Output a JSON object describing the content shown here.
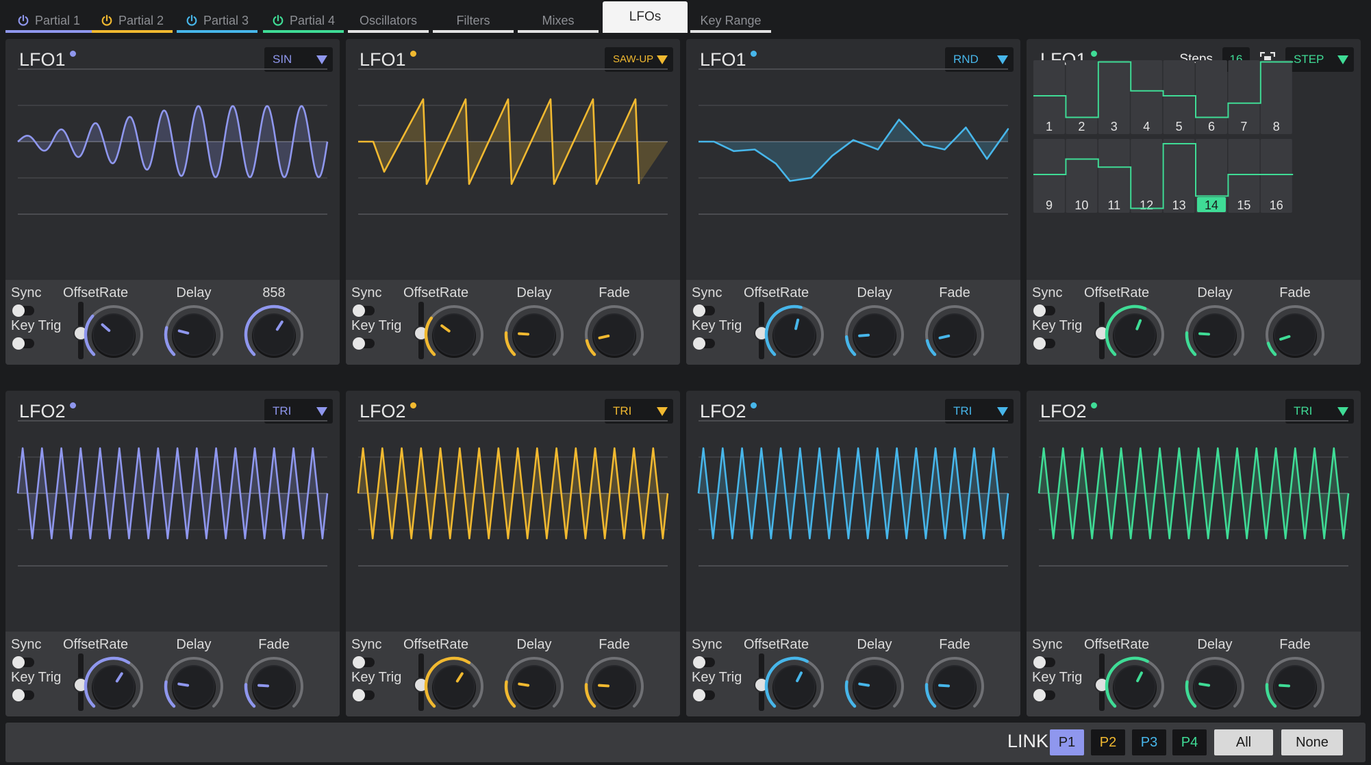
{
  "tabs": [
    {
      "label": "Partial 1",
      "power": true,
      "color": "#8f97ee"
    },
    {
      "label": "Partial 2",
      "power": true,
      "color": "#f1b930"
    },
    {
      "label": "Partial 3",
      "power": true,
      "color": "#47b6ea"
    },
    {
      "label": "Partial 4",
      "power": true,
      "color": "#3fdc96"
    },
    {
      "label": "Oscillators",
      "power": false
    },
    {
      "label": "Filters",
      "power": false
    },
    {
      "label": "Mixes",
      "power": false
    },
    {
      "label": "LFOs",
      "power": false,
      "active": true
    },
    {
      "label": "Key Range",
      "power": false
    }
  ],
  "partial_colors": [
    "#8f97ee",
    "#f1b930",
    "#47b6ea",
    "#3fdc96"
  ],
  "controls_labels": {
    "sync": "Sync",
    "offset": "Offset",
    "key_trig": "Key Trig",
    "rate": "Rate",
    "delay": "Delay",
    "fade": "Fade"
  },
  "lfo1": [
    {
      "title": "LFO1",
      "shape": "SIN",
      "third_knob_label": "858",
      "knobs": {
        "rate": 0.32,
        "delay": 0.22,
        "fade": 0.62
      }
    },
    {
      "title": "LFO1",
      "shape": "SAW-UP",
      "third_knob_label": "Fade",
      "knobs": {
        "rate": 0.3,
        "delay": 0.18,
        "fade": 0.12
      }
    },
    {
      "title": "LFO1",
      "shape": "RND",
      "third_knob_label": "Fade",
      "knobs": {
        "rate": 0.55,
        "delay": 0.15,
        "fade": 0.12
      }
    },
    {
      "title": "LFO1",
      "shape": "STEP",
      "third_knob_label": "Fade",
      "knobs": {
        "rate": 0.58,
        "delay": 0.18,
        "fade": 0.1
      },
      "steps_label": "Steps",
      "steps_value": "16",
      "step_labels": [
        "1",
        "2",
        "3",
        "4",
        "5",
        "6",
        "7",
        "8",
        "9",
        "10",
        "11",
        "12",
        "13",
        "14",
        "15",
        "16"
      ],
      "step_values": [
        0.0,
        -0.35,
        0.55,
        0.08,
        0.0,
        -0.35,
        -0.12,
        0.55,
        0.0,
        0.25,
        0.12,
        -0.55,
        0.5,
        -0.35,
        0.0,
        0.0
      ],
      "selected_step": "14"
    }
  ],
  "lfo2": [
    {
      "title": "LFO2",
      "shape": "TRI",
      "third_knob_label": "Fade",
      "knobs": {
        "rate": 0.62,
        "delay": 0.2,
        "fade": 0.18
      }
    },
    {
      "title": "LFO2",
      "shape": "TRI",
      "third_knob_label": "Fade",
      "knobs": {
        "rate": 0.62,
        "delay": 0.2,
        "fade": 0.18
      }
    },
    {
      "title": "LFO2",
      "shape": "TRI",
      "third_knob_label": "Fade",
      "knobs": {
        "rate": 0.6,
        "delay": 0.2,
        "fade": 0.18
      }
    },
    {
      "title": "LFO2",
      "shape": "TRI",
      "third_knob_label": "Fade",
      "knobs": {
        "rate": 0.6,
        "delay": 0.2,
        "fade": 0.18
      }
    }
  ],
  "link_bar": {
    "label": "LINK",
    "buttons": [
      {
        "label": "P1",
        "active": true
      },
      {
        "label": "P2",
        "active": false
      },
      {
        "label": "P3",
        "active": false
      },
      {
        "label": "P4",
        "active": false
      },
      {
        "label": "All"
      },
      {
        "label": "None"
      }
    ]
  }
}
